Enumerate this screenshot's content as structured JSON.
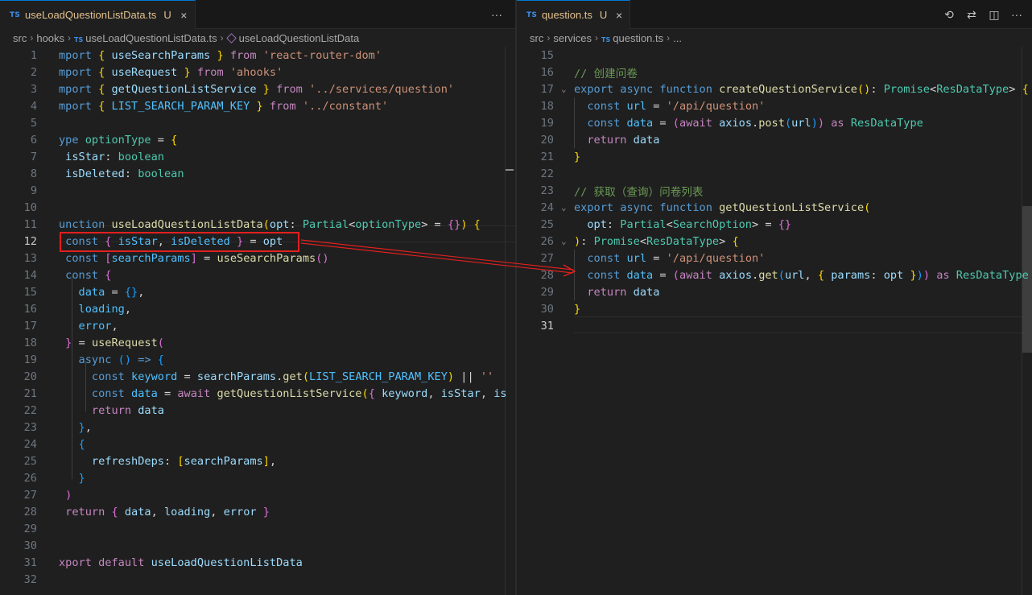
{
  "left": {
    "tab": {
      "lang": "TS",
      "name": "useLoadQuestionListData.ts",
      "status": "U",
      "close": "×"
    },
    "actions": {
      "more": "···"
    },
    "breadcrumb": [
      "src",
      "hooks",
      "useLoadQuestionListData.ts",
      "useLoadQuestionListData"
    ],
    "breadcrumb_lang": "TS",
    "current_line": "12",
    "lines": [
      {
        "n": "1",
        "t": [
          [
            "k",
            "mport "
          ],
          [
            "y",
            "{ "
          ],
          [
            "v",
            "useSearchParams "
          ],
          [
            "y",
            "} "
          ],
          [
            "c",
            "from "
          ],
          [
            "s",
            "'react-router-dom'"
          ]
        ]
      },
      {
        "n": "2",
        "t": [
          [
            "k",
            "mport "
          ],
          [
            "y",
            "{ "
          ],
          [
            "v",
            "useRequest "
          ],
          [
            "y",
            "} "
          ],
          [
            "c",
            "from "
          ],
          [
            "s",
            "'ahooks'"
          ]
        ]
      },
      {
        "n": "3",
        "t": [
          [
            "k",
            "mport "
          ],
          [
            "y",
            "{ "
          ],
          [
            "v",
            "getQuestionListService "
          ],
          [
            "y",
            "} "
          ],
          [
            "c",
            "from "
          ],
          [
            "s",
            "'../services/question'"
          ]
        ]
      },
      {
        "n": "4",
        "t": [
          [
            "k",
            "mport "
          ],
          [
            "y",
            "{ "
          ],
          [
            "cn",
            "LIST_SEARCH_PARAM_KEY "
          ],
          [
            "y",
            "} "
          ],
          [
            "c",
            "from "
          ],
          [
            "s",
            "'../constant'"
          ]
        ]
      },
      {
        "n": "5",
        "t": []
      },
      {
        "n": "6",
        "t": [
          [
            "k",
            "ype "
          ],
          [
            "t",
            "optionType "
          ],
          [
            "w",
            "= "
          ],
          [
            "y",
            "{"
          ]
        ]
      },
      {
        "n": "7",
        "t": [
          [
            "v",
            " isStar"
          ],
          [
            "w",
            ": "
          ],
          [
            "t",
            "boolean"
          ]
        ]
      },
      {
        "n": "8",
        "t": [
          [
            "v",
            " isDeleted"
          ],
          [
            "w",
            ": "
          ],
          [
            "t",
            "boolean"
          ]
        ]
      },
      {
        "n": "9",
        "t": []
      },
      {
        "n": "10",
        "t": []
      },
      {
        "n": "11",
        "t": [
          [
            "k",
            "unction "
          ],
          [
            "f",
            "useLoadQuestionListData"
          ],
          [
            "y",
            "("
          ],
          [
            "v",
            "opt"
          ],
          [
            "w",
            ": "
          ],
          [
            "t",
            "Partial"
          ],
          [
            "w",
            "<"
          ],
          [
            "t",
            "optionType"
          ],
          [
            "w",
            "> = "
          ],
          [
            "p",
            "{}"
          ],
          [
            "y",
            ") {"
          ]
        ]
      },
      {
        "n": "12",
        "t": [
          [
            "k",
            " const "
          ],
          [
            "p",
            "{ "
          ],
          [
            "cn",
            "isStar"
          ],
          [
            "w",
            ", "
          ],
          [
            "cn",
            "isDeleted "
          ],
          [
            "p",
            "} "
          ],
          [
            "w",
            "= "
          ],
          [
            "v",
            "opt"
          ]
        ]
      },
      {
        "n": "13",
        "t": [
          [
            "k",
            " const "
          ],
          [
            "p",
            "["
          ],
          [
            "cn",
            "searchParams"
          ],
          [
            "p",
            "] "
          ],
          [
            "w",
            "= "
          ],
          [
            "f",
            "useSearchParams"
          ],
          [
            "p",
            "()"
          ]
        ]
      },
      {
        "n": "14",
        "t": [
          [
            "k",
            " const "
          ],
          [
            "p",
            "{"
          ]
        ]
      },
      {
        "n": "15",
        "t": [
          [
            "cn",
            "   data "
          ],
          [
            "w",
            "= "
          ],
          [
            "b",
            "{}"
          ],
          [
            "w",
            ","
          ]
        ]
      },
      {
        "n": "16",
        "t": [
          [
            "cn",
            "   loading"
          ],
          [
            "w",
            ","
          ]
        ]
      },
      {
        "n": "17",
        "t": [
          [
            "cn",
            "   error"
          ],
          [
            "w",
            ","
          ]
        ]
      },
      {
        "n": "18",
        "t": [
          [
            "p",
            " } "
          ],
          [
            "w",
            "= "
          ],
          [
            "f",
            "useRequest"
          ],
          [
            "p",
            "("
          ]
        ]
      },
      {
        "n": "19",
        "t": [
          [
            "k",
            "   async "
          ],
          [
            "b",
            "() "
          ],
          [
            "k",
            "=> "
          ],
          [
            "b",
            "{"
          ]
        ]
      },
      {
        "n": "20",
        "t": [
          [
            "k",
            "     const "
          ],
          [
            "cn",
            "keyword "
          ],
          [
            "w",
            "= "
          ],
          [
            "v",
            "searchParams"
          ],
          [
            "w",
            "."
          ],
          [
            "f",
            "get"
          ],
          [
            "y",
            "("
          ],
          [
            "cn",
            "LIST_SEARCH_PARAM_KEY"
          ],
          [
            "y",
            ") "
          ],
          [
            "w",
            "|| "
          ],
          [
            "s",
            "''"
          ]
        ]
      },
      {
        "n": "21",
        "t": [
          [
            "k",
            "     const "
          ],
          [
            "cn",
            "data "
          ],
          [
            "w",
            "= "
          ],
          [
            "c",
            "await "
          ],
          [
            "f",
            "getQuestionListService"
          ],
          [
            "y",
            "("
          ],
          [
            "p",
            "{ "
          ],
          [
            "v",
            "keyword"
          ],
          [
            "w",
            ", "
          ],
          [
            "v",
            "isStar"
          ],
          [
            "w",
            ", "
          ],
          [
            "v",
            "is"
          ]
        ]
      },
      {
        "n": "22",
        "t": [
          [
            "c",
            "     return "
          ],
          [
            "v",
            "data"
          ]
        ]
      },
      {
        "n": "23",
        "t": [
          [
            "b",
            "   }"
          ],
          [
            "w",
            ","
          ]
        ]
      },
      {
        "n": "24",
        "t": [
          [
            "b",
            "   {"
          ]
        ]
      },
      {
        "n": "25",
        "t": [
          [
            "v",
            "     refreshDeps"
          ],
          [
            "w",
            ": "
          ],
          [
            "y",
            "["
          ],
          [
            "v",
            "searchParams"
          ],
          [
            "y",
            "]"
          ],
          [
            "w",
            ","
          ]
        ]
      },
      {
        "n": "26",
        "t": [
          [
            "b",
            "   }"
          ]
        ]
      },
      {
        "n": "27",
        "t": [
          [
            "p",
            " )"
          ]
        ]
      },
      {
        "n": "28",
        "t": [
          [
            "c",
            " return "
          ],
          [
            "p",
            "{ "
          ],
          [
            "v",
            "data"
          ],
          [
            "w",
            ", "
          ],
          [
            "v",
            "loading"
          ],
          [
            "w",
            ", "
          ],
          [
            "v",
            "error "
          ],
          [
            "p",
            "}"
          ]
        ]
      },
      {
        "n": "29",
        "t": []
      },
      {
        "n": "30",
        "t": []
      },
      {
        "n": "31",
        "t": [
          [
            "c",
            "xport default "
          ],
          [
            "v",
            "useLoadQuestionListData"
          ]
        ]
      },
      {
        "n": "32",
        "t": []
      }
    ]
  },
  "right": {
    "tab": {
      "lang": "TS",
      "name": "question.ts",
      "status": "U",
      "close": "×"
    },
    "actions": {
      "history": "⟲",
      "compare": "⇄",
      "split": "◫",
      "more": "···"
    },
    "breadcrumb": [
      "src",
      "services",
      "question.ts",
      "..."
    ],
    "breadcrumb_lang": "TS",
    "current_line": "31",
    "lines": [
      {
        "n": "15",
        "t": []
      },
      {
        "n": "16",
        "t": [
          [
            "cm",
            "// 创建问卷"
          ]
        ]
      },
      {
        "n": "17",
        "fold": "⌄",
        "t": [
          [
            "k",
            "export "
          ],
          [
            "k",
            "async "
          ],
          [
            "k",
            "function "
          ],
          [
            "f",
            "createQuestionService"
          ],
          [
            "y",
            "()"
          ],
          [
            "w",
            ": "
          ],
          [
            "t",
            "Promise"
          ],
          [
            "w",
            "<"
          ],
          [
            "t",
            "ResDataType"
          ],
          [
            "w",
            "> "
          ],
          [
            "y",
            "{"
          ]
        ]
      },
      {
        "n": "18",
        "t": [
          [
            "k",
            "  const "
          ],
          [
            "cn",
            "url "
          ],
          [
            "w",
            "= "
          ],
          [
            "s",
            "'/api/question'"
          ]
        ]
      },
      {
        "n": "19",
        "t": [
          [
            "k",
            "  const "
          ],
          [
            "cn",
            "data "
          ],
          [
            "w",
            "= "
          ],
          [
            "p",
            "("
          ],
          [
            "c",
            "await "
          ],
          [
            "v",
            "axios"
          ],
          [
            "w",
            "."
          ],
          [
            "f",
            "post"
          ],
          [
            "b",
            "("
          ],
          [
            "v",
            "url"
          ],
          [
            "b",
            ")"
          ],
          [
            "p",
            ") "
          ],
          [
            "c",
            "as "
          ],
          [
            "t",
            "ResDataType"
          ]
        ]
      },
      {
        "n": "20",
        "t": [
          [
            "c",
            "  return "
          ],
          [
            "v",
            "data"
          ]
        ]
      },
      {
        "n": "21",
        "t": [
          [
            "y",
            "}"
          ]
        ]
      },
      {
        "n": "22",
        "t": []
      },
      {
        "n": "23",
        "t": [
          [
            "cm",
            "// 获取（查询）问卷列表"
          ]
        ]
      },
      {
        "n": "24",
        "fold": "⌄",
        "t": [
          [
            "k",
            "export "
          ],
          [
            "k",
            "async "
          ],
          [
            "k",
            "function "
          ],
          [
            "f",
            "getQuestionListService"
          ],
          [
            "y",
            "("
          ]
        ]
      },
      {
        "n": "25",
        "t": [
          [
            "v",
            "  opt"
          ],
          [
            "w",
            ": "
          ],
          [
            "t",
            "Partial"
          ],
          [
            "w",
            "<"
          ],
          [
            "t",
            "SearchOption"
          ],
          [
            "w",
            "> = "
          ],
          [
            "p",
            "{}"
          ]
        ]
      },
      {
        "n": "26",
        "fold": "⌄",
        "t": [
          [
            "y",
            ")"
          ],
          [
            "w",
            ": "
          ],
          [
            "t",
            "Promise"
          ],
          [
            "w",
            "<"
          ],
          [
            "t",
            "ResDataType"
          ],
          [
            "w",
            "> "
          ],
          [
            "y",
            "{"
          ]
        ]
      },
      {
        "n": "27",
        "t": [
          [
            "k",
            "  const "
          ],
          [
            "cn",
            "url "
          ],
          [
            "w",
            "= "
          ],
          [
            "s",
            "'/api/question'"
          ]
        ]
      },
      {
        "n": "28",
        "t": [
          [
            "k",
            "  const "
          ],
          [
            "cn",
            "data "
          ],
          [
            "w",
            "= "
          ],
          [
            "p",
            "("
          ],
          [
            "c",
            "await "
          ],
          [
            "v",
            "axios"
          ],
          [
            "w",
            "."
          ],
          [
            "f",
            "get"
          ],
          [
            "b",
            "("
          ],
          [
            "v",
            "url"
          ],
          [
            "w",
            ", "
          ],
          [
            "y",
            "{ "
          ],
          [
            "v",
            "params"
          ],
          [
            "w",
            ": "
          ],
          [
            "v",
            "opt "
          ],
          [
            "y",
            "}"
          ],
          [
            "b",
            ")"
          ],
          [
            "p",
            ") "
          ],
          [
            "c",
            "as "
          ],
          [
            "t",
            "ResDataType"
          ]
        ]
      },
      {
        "n": "29",
        "t": [
          [
            "c",
            "  return "
          ],
          [
            "v",
            "data"
          ]
        ]
      },
      {
        "n": "30",
        "t": [
          [
            "y",
            "}"
          ]
        ]
      },
      {
        "n": "31",
        "t": []
      }
    ]
  }
}
